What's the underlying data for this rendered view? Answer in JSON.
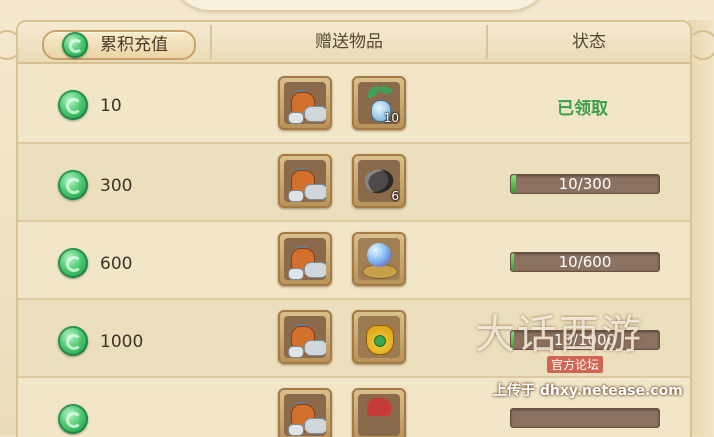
{
  "header": {
    "col_recharge": "累积充值",
    "col_gift": "赠送物品",
    "col_status": "状态"
  },
  "rows": [
    {
      "amount": "10",
      "items": [
        {
          "icon": "coin-bag-icon",
          "qty": ""
        },
        {
          "icon": "plant-bottle-icon",
          "qty": "10"
        }
      ],
      "status_text": "已领取",
      "progress": null
    },
    {
      "amount": "300",
      "items": [
        {
          "icon": "coin-bag-icon",
          "qty": ""
        },
        {
          "icon": "ore-stone-icon",
          "qty": "6"
        }
      ],
      "status_text": "10/300",
      "progress": 0.033
    },
    {
      "amount": "600",
      "items": [
        {
          "icon": "coin-bag-icon",
          "qty": ""
        },
        {
          "icon": "crystal-orb-icon",
          "qty": ""
        }
      ],
      "status_text": "10/600",
      "progress": 0.017
    },
    {
      "amount": "1000",
      "items": [
        {
          "icon": "coin-bag-icon",
          "qty": ""
        },
        {
          "icon": "lucky-bag-icon",
          "qty": ""
        }
      ],
      "status_text": "10/1000",
      "progress": 0.01
    }
  ],
  "watermark": {
    "title": "大话西游",
    "subtitle": "官方论坛",
    "url": "上传于 dhxy.netease.com"
  },
  "colors": {
    "claimed_text": "#3aa049",
    "progress_fill": "#3fae3f",
    "progress_track": "#8a7160"
  }
}
